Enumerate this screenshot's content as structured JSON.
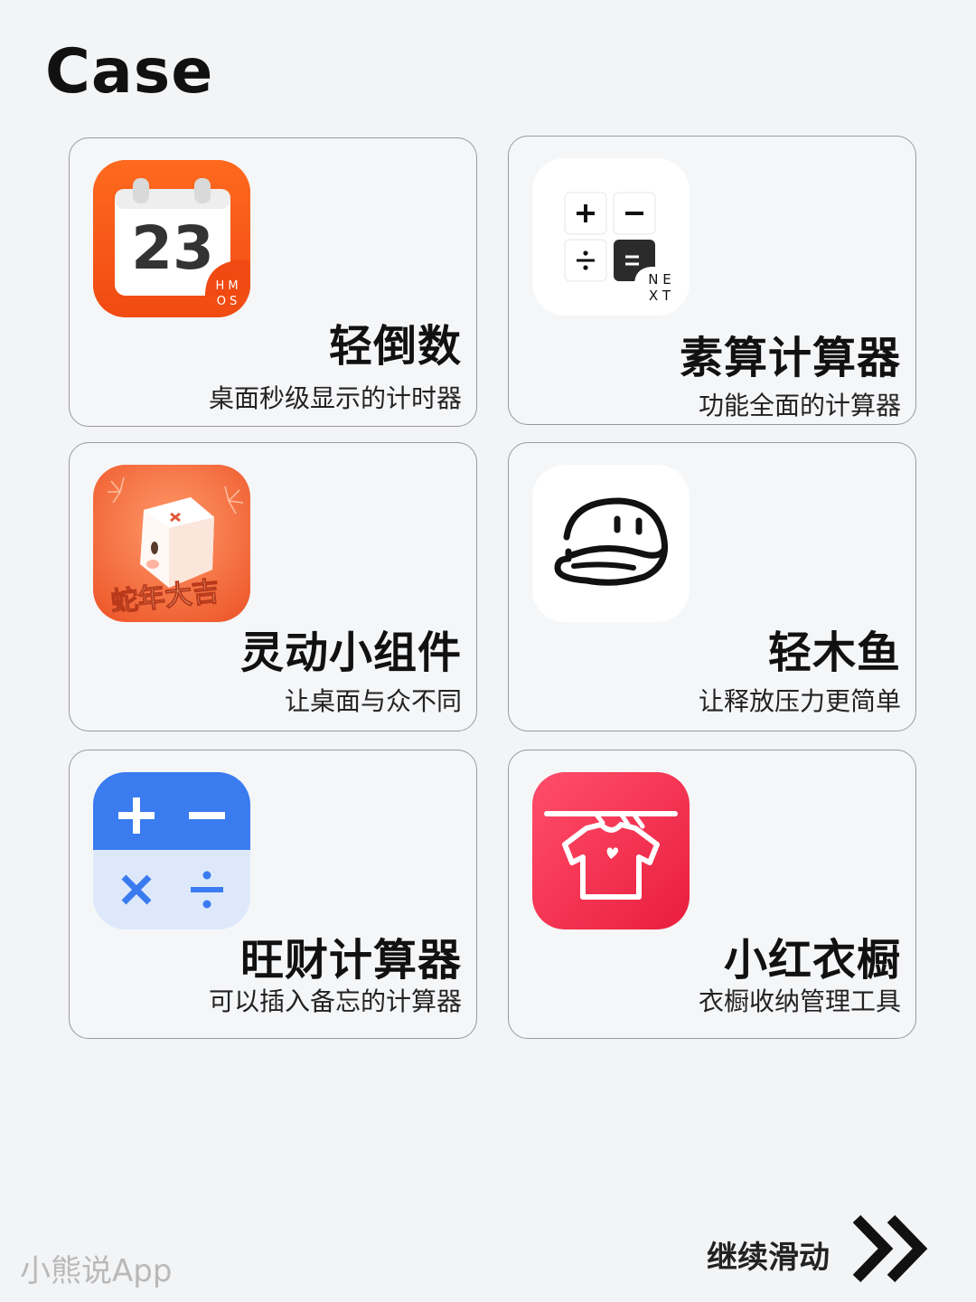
{
  "page_title": "Case",
  "cards": [
    {
      "name": "轻倒数",
      "desc": "桌面秒级显示的计时器",
      "icon": "calendar-countdown-icon",
      "icon_text": "23",
      "badge_text": "HMOS",
      "accent": "#f5531c"
    },
    {
      "name": "素算计算器",
      "desc": "功能全面的计算器",
      "icon": "calculator-keys-icon",
      "badge_text": "NEXT",
      "accent": "#222222"
    },
    {
      "name": "灵动小组件",
      "desc": "让桌面与众不同",
      "icon": "tofu-mascot-icon",
      "badge_text": "蛇年大吉",
      "accent": "#f26a3d"
    },
    {
      "name": "轻木鱼",
      "desc": "让释放压力更简单",
      "icon": "wooden-fish-icon",
      "accent": "#111111"
    },
    {
      "name": "旺财计算器",
      "desc": "可以插入备忘的计算器",
      "icon": "calculator-operators-icon",
      "accent": "#3a7bf0"
    },
    {
      "name": "小红衣橱",
      "desc": "衣橱收纳管理工具",
      "icon": "clothes-hanger-icon",
      "accent": "#f0284a"
    }
  ],
  "footer": {
    "watermark": "小熊说App",
    "continue_label": "继续滑动"
  }
}
